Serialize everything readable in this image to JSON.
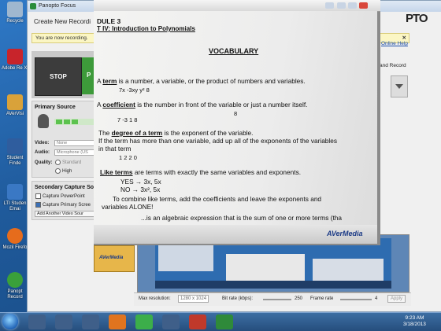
{
  "desktop": {
    "icons": [
      {
        "label": "Recycle",
        "color": "#9fb7cf"
      },
      {
        "label": "Adobe Re XI",
        "color": "#c8242b"
      },
      {
        "label": "AVerVisi",
        "color": "#d9a23a"
      },
      {
        "label": "Student Finde",
        "color": "#2f5d9e"
      },
      {
        "label": "LTI Studen Emai",
        "color": "#3a78c4"
      },
      {
        "label": "Mozil Firefo",
        "color": "#e66c1c"
      },
      {
        "label": "Panopt Record",
        "color": "#3aa03a"
      }
    ]
  },
  "panopto": {
    "title": "Panopto Focus",
    "window_heading": "Create New Recordi",
    "brand": "PTO",
    "notice": "You are now recording.",
    "online_help": "Online Help",
    "add_and_record": "and Record",
    "stop_label": "STOP",
    "green_label": "P",
    "primary_source": {
      "title": "Primary Source",
      "video_label": "Video:",
      "video_value": "None",
      "audio_label": "Audio:",
      "audio_value": "Microphone (US",
      "quality_label": "Quality:",
      "standard": "Standard",
      "high": "High"
    },
    "secondary_source": {
      "title": "Secondary Capture So",
      "capture_powerpoint": "Capture PowerPoint",
      "capture_primary_screen": "Capture Primary Scree",
      "add_another": "Add Another Video Sour"
    },
    "bottom": {
      "max_resolution_label": "Max resolution:",
      "max_resolution_value": "1280 x 1024",
      "bit_rate_label": "Bit rate (kbps):",
      "bit_rate_value": "250",
      "frame_rate_label": "Frame rate",
      "frame_rate_value": "4",
      "apply": "Apply"
    }
  },
  "document": {
    "module": "DULE 3",
    "unit": "T IV: Introduction to Polynomials",
    "heading": "VOCABULARY",
    "lines": [
      {
        "id": "term_def",
        "text": "A term is a number, a variable, or the product of numbers and variables."
      },
      {
        "id": "term_ex",
        "text": "7x         -3xy           y²            8"
      },
      {
        "id": "coef_def",
        "text": "A coefficient is the number in front of the variable or just a number itself."
      },
      {
        "id": "coef_nums_top",
        "text": "                                    8"
      },
      {
        "id": "coef_nums",
        "text": "7               -3            1          8"
      },
      {
        "id": "degree_def",
        "text": "The degree of a term is the exponent of the variable."
      },
      {
        "id": "degree_more",
        "text": "If the term has more than one variable, add up all of the exponents of the variables"
      },
      {
        "id": "degree_in",
        "text": "in that term"
      },
      {
        "id": "degree_ex",
        "text": "1                2              2             0"
      },
      {
        "id": "like_def",
        "text": "Like terms are terms with exactly the same variables and exponents."
      },
      {
        "id": "yes",
        "text": "YES →      3x,  5x"
      },
      {
        "id": "no",
        "text": "NO  →      3x²,  5x"
      },
      {
        "id": "combine",
        "text": "To combine like terms, add the coefficients and leave the exponents and"
      },
      {
        "id": "variables_alone",
        "text": "variables ALONE!"
      },
      {
        "id": "poly",
        "text": "...is an algebraic expression that is the sum of one or more terms (tha"
      }
    ],
    "brand": "AVerMedia"
  },
  "taskbar": {
    "time": "9:23 AM",
    "date": "3/18/2013"
  }
}
